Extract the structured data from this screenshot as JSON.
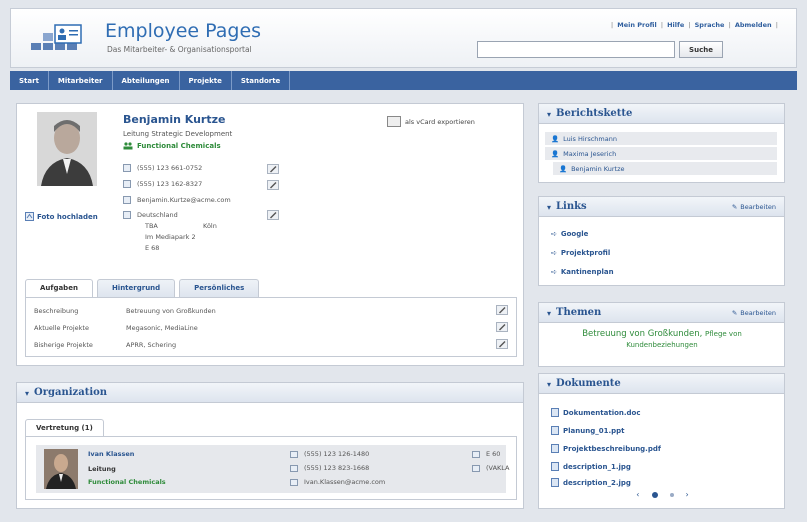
{
  "header": {
    "title": "Employee Pages",
    "subtitle": "Das Mitarbeiter- & Organisationsportal",
    "links": [
      "Mein Profil",
      "Hilfe",
      "Sprache",
      "Abmelden"
    ],
    "search_placeholder": "",
    "search_button": "Suche"
  },
  "nav": [
    "Start",
    "Mitarbeiter",
    "Abteilungen",
    "Projekte",
    "Standorte"
  ],
  "profile": {
    "name": "Benjamin Kurtze",
    "role": "Leitung Strategic Development",
    "company": "Functional Chemicals",
    "phone1": "(555) 123 661-0752",
    "phone2": "(555) 123 162-8327",
    "email": "Benjamin.Kurtze@acme.com",
    "address_line1": "Deutschland",
    "address_line2a": "TBA",
    "address_line2b": "Köln",
    "address_line3": "Im Mediapark 2",
    "address_line4": "E 68",
    "vcard": "als vCard exportieren",
    "photo_upload": "Foto hochladen"
  },
  "tabs": [
    "Aufgaben",
    "Hintergrund",
    "Persönliches"
  ],
  "tasks": [
    {
      "key": "Beschreibung",
      "value": "Betreuung von Großkunden"
    },
    {
      "key": "Aktuelle Projekte",
      "value": "Megasonic, MediaLine"
    },
    {
      "key": "Bisherige Projekte",
      "value": "APRR, Schering"
    }
  ],
  "organization": {
    "title": "Organization",
    "tab": "Vertretung (1)",
    "person_name": "Ivan Klassen",
    "person_role": "Leitung",
    "person_company": "Functional Chemicals",
    "phone1": "(555) 123 126-1480",
    "phone2": "(555) 123 823-1668",
    "email": "Ivan.Klassen@acme.com",
    "room": "E 60",
    "flag": "(VAKLA"
  },
  "berichtskette": {
    "title": "Berichtskette",
    "items": [
      "Luis Hirschmann",
      "Maxima Jeserich",
      "Benjamin Kurtze"
    ]
  },
  "links": {
    "title": "Links",
    "edit": "Bearbeiten",
    "items": [
      "Google",
      "Projektprofil",
      "Kantinenplan"
    ]
  },
  "themen": {
    "title": "Themen",
    "edit": "Bearbeiten",
    "text_main": "Betreuung von Großkunden,",
    "text_rest": "Pflege von Kundenbeziehungen"
  },
  "dokumente": {
    "title": "Dokumente",
    "items": [
      "Dokumentation.doc",
      "Planung_01.ppt",
      "Projektbeschreibung.pdf",
      "description_1.jpg",
      "description_2.jpg"
    ]
  }
}
